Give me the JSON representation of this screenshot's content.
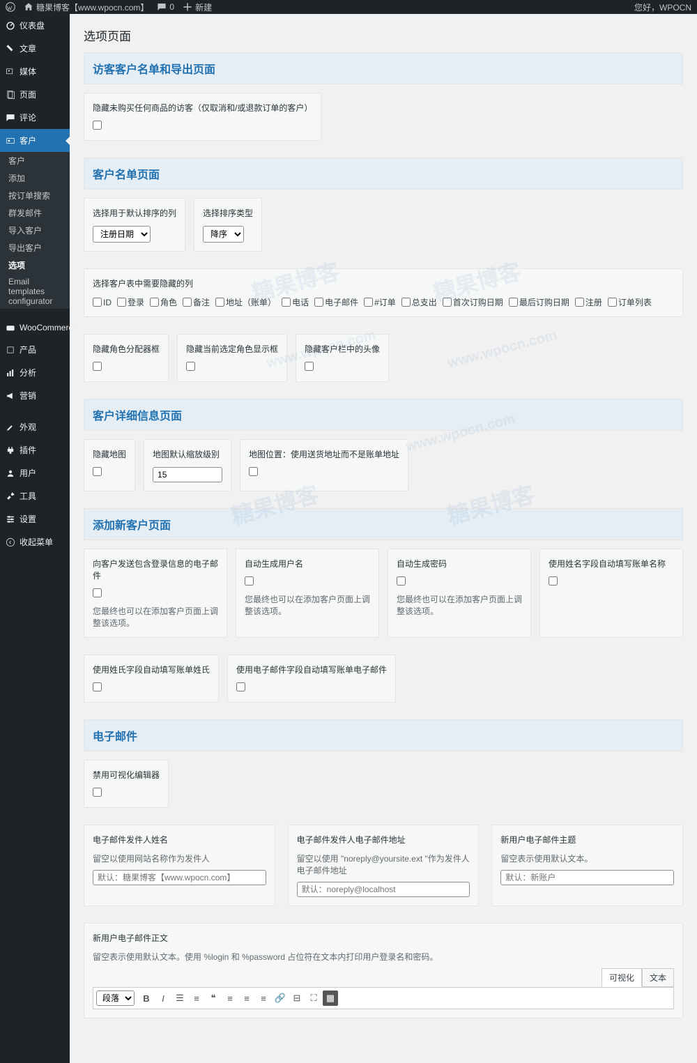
{
  "adminbar": {
    "site_name": "糖果博客【www.wpocn.com】",
    "comments": "0",
    "new": "新建",
    "greeting": "您好，WPOCN"
  },
  "sidebar": {
    "items": [
      {
        "label": "仪表盘",
        "icon": "dashboard"
      },
      {
        "label": "文章",
        "icon": "pin"
      },
      {
        "label": "媒体",
        "icon": "media"
      },
      {
        "label": "页面",
        "icon": "page"
      },
      {
        "label": "评论",
        "icon": "comment"
      },
      {
        "label": "客户",
        "icon": "id",
        "current": true
      },
      {
        "label": "WooCommerce",
        "icon": "woo"
      },
      {
        "label": "产品",
        "icon": "product"
      },
      {
        "label": "分析",
        "icon": "chart"
      },
      {
        "label": "营销",
        "icon": "megaphone"
      },
      {
        "label": "外观",
        "icon": "brush"
      },
      {
        "label": "插件",
        "icon": "plugin"
      },
      {
        "label": "用户",
        "icon": "user"
      },
      {
        "label": "工具",
        "icon": "tool"
      },
      {
        "label": "设置",
        "icon": "gear"
      },
      {
        "label": "收起菜单",
        "icon": "collapse"
      }
    ],
    "submenu": [
      "客户",
      "添加",
      "按订单搜索",
      "群发邮件",
      "导入客户",
      "导出客户",
      "选项",
      "Email templates configurator"
    ],
    "submenu_active": "选项"
  },
  "page": {
    "title": "选项页面"
  },
  "sections": {
    "s1": {
      "title": "访客客户名单和导出页面",
      "hide_guest_label": "隐藏未购买任何商品的访客（仅取消和/或退款订单的客户）"
    },
    "s2": {
      "title": "客户名单页面",
      "sort_col_label": "选择用于默认排序的列",
      "sort_col_value": "注册日期",
      "sort_type_label": "选择排序类型",
      "sort_type_value": "降序",
      "hide_cols_label": "选择客户表中需要隐藏的列",
      "cols": [
        "ID",
        "登录",
        "角色",
        "备注",
        "地址（账单）",
        "电话",
        "电子邮件",
        "#订单",
        "总支出",
        "首次订购日期",
        "最后订购日期",
        "注册",
        "订单列表"
      ],
      "hide_role_label": "隐藏角色分配器框",
      "hide_roles_box_label": "隐藏当前选定角色显示框",
      "hide_avatar_label": "隐藏客户栏中的头像"
    },
    "s3": {
      "title": "客户详细信息页面",
      "hide_map_label": "隐藏地图",
      "zoom_label": "地图默认缩放级别",
      "zoom_value": "15",
      "map_pos_label": "地图位置：使用送货地址而不是账单地址"
    },
    "s4": {
      "title": "添加新客户页面",
      "send_email_label": "向客户发送包含登录信息的电子邮件",
      "auto_user_label": "自动生成用户名",
      "auto_pass_label": "自动生成密码",
      "autofill_bill_name_label": "使用姓名字段自动填写账单名称",
      "help1": "您最终也可以在添加客户页面上调整该选项。",
      "autofill_lastname_label": "使用姓氏字段自动填写账单姓氏",
      "autofill_email_label": "使用电子邮件字段自动填写账单电子邮件"
    },
    "s5": {
      "title": "电子邮件",
      "disable_visual_label": "禁用可视化编辑器",
      "sender_name_label": "电子邮件发件人姓名",
      "sender_name_help": "留空以使用网站名称作为发件人",
      "sender_name_ph": "默认：糖果博客【www.wpocn.com】",
      "sender_email_label": "电子邮件发件人电子邮件地址",
      "sender_email_help": "留空以使用 \"noreply@yoursite.ext \"作为发件人电子邮件地址",
      "sender_email_ph": "默认：noreply@localhost",
      "subject_label": "新用户电子邮件主题",
      "subject_help": "留空表示使用默认文本。",
      "subject_ph": "默认：新账户",
      "body_label": "新用户电子邮件正文",
      "body_help": "留空表示使用默认文本。使用 %login 和 %password 占位符在文本内打印用户登录名和密码。",
      "tab_visual": "可视化",
      "tab_text": "文本",
      "toolbar_format": "段落"
    }
  }
}
